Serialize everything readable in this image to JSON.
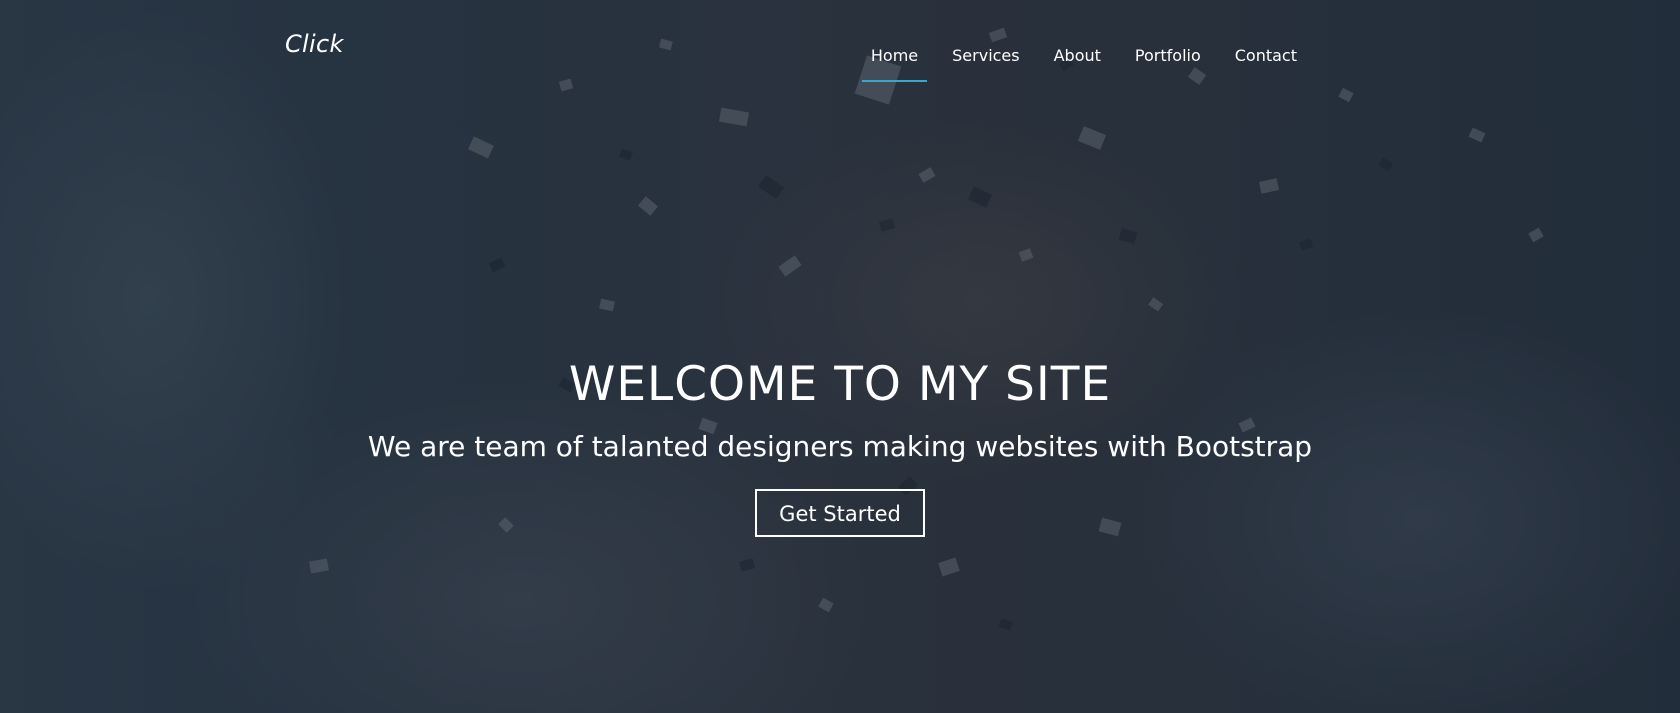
{
  "navbar": {
    "brand": "Click",
    "links": [
      {
        "label": "Home",
        "active": true
      },
      {
        "label": "Services",
        "active": false
      },
      {
        "label": "About",
        "active": false
      },
      {
        "label": "Portfolio",
        "active": false
      },
      {
        "label": "Contact",
        "active": false
      }
    ],
    "active_indicator_color": "#3aa6c9"
  },
  "hero": {
    "title": "WELCOME TO MY SITE",
    "subtitle": "We are team of talanted designers making websites with Bootstrap",
    "cta_label": "Get Started",
    "background": "party-confetti-photo"
  },
  "colors": {
    "overlay": "#1b2837",
    "text": "#ffffff"
  }
}
